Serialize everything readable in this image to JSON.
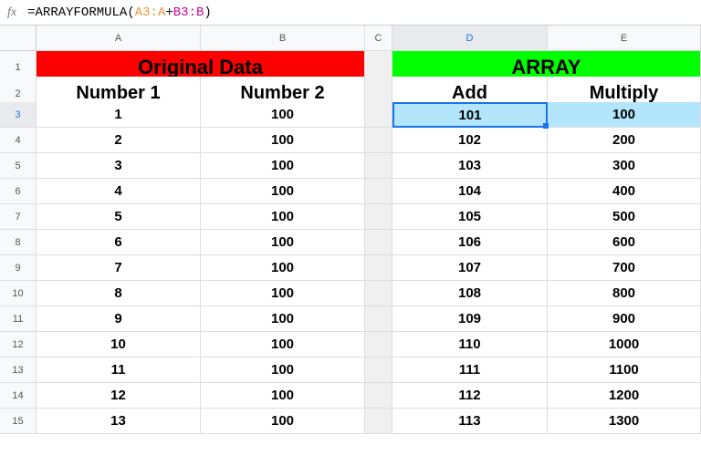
{
  "formula_bar": {
    "fx": "fx",
    "eq": "=",
    "fn": "ARRAYFORMULA",
    "open": "(",
    "ref1": "A3:A",
    "op": "+",
    "ref2": "B3:B",
    "close": ")"
  },
  "columns": [
    "A",
    "B",
    "C",
    "D",
    "E"
  ],
  "header_titles": {
    "original": "Original Data",
    "array": "ARRAY"
  },
  "subheaders": {
    "a": "Number 1",
    "b": "Number 2",
    "d": "Add",
    "e": "Multiply"
  },
  "rows": [
    {
      "n": "3",
      "a": "1",
      "b": "100",
      "d": "101",
      "e": "100"
    },
    {
      "n": "4",
      "a": "2",
      "b": "100",
      "d": "102",
      "e": "200"
    },
    {
      "n": "5",
      "a": "3",
      "b": "100",
      "d": "103",
      "e": "300"
    },
    {
      "n": "6",
      "a": "4",
      "b": "100",
      "d": "104",
      "e": "400"
    },
    {
      "n": "7",
      "a": "5",
      "b": "100",
      "d": "105",
      "e": "500"
    },
    {
      "n": "8",
      "a": "6",
      "b": "100",
      "d": "106",
      "e": "600"
    },
    {
      "n": "9",
      "a": "7",
      "b": "100",
      "d": "107",
      "e": "700"
    },
    {
      "n": "10",
      "a": "8",
      "b": "100",
      "d": "108",
      "e": "800"
    },
    {
      "n": "11",
      "a": "9",
      "b": "100",
      "d": "109",
      "e": "900"
    },
    {
      "n": "12",
      "a": "10",
      "b": "100",
      "d": "110",
      "e": "1000"
    },
    {
      "n": "13",
      "a": "11",
      "b": "100",
      "d": "111",
      "e": "1100"
    },
    {
      "n": "14",
      "a": "12",
      "b": "100",
      "d": "112",
      "e": "1200"
    },
    {
      "n": "15",
      "a": "13",
      "b": "100",
      "d": "113",
      "e": "1300"
    }
  ],
  "row_labels": {
    "r1": "1",
    "r2": "2"
  },
  "chart_data": {
    "type": "table",
    "title": "ARRAYFORMULA example",
    "columns": [
      "Number 1",
      "Number 2",
      "Add",
      "Multiply"
    ],
    "series": [
      {
        "name": "Number 1",
        "values": [
          1,
          2,
          3,
          4,
          5,
          6,
          7,
          8,
          9,
          10,
          11,
          12,
          13
        ]
      },
      {
        "name": "Number 2",
        "values": [
          100,
          100,
          100,
          100,
          100,
          100,
          100,
          100,
          100,
          100,
          100,
          100,
          100
        ]
      },
      {
        "name": "Add",
        "values": [
          101,
          102,
          103,
          104,
          105,
          106,
          107,
          108,
          109,
          110,
          111,
          112,
          113
        ]
      },
      {
        "name": "Multiply",
        "values": [
          100,
          200,
          300,
          400,
          500,
          600,
          700,
          800,
          900,
          1000,
          1100,
          1200,
          1300
        ]
      }
    ]
  }
}
